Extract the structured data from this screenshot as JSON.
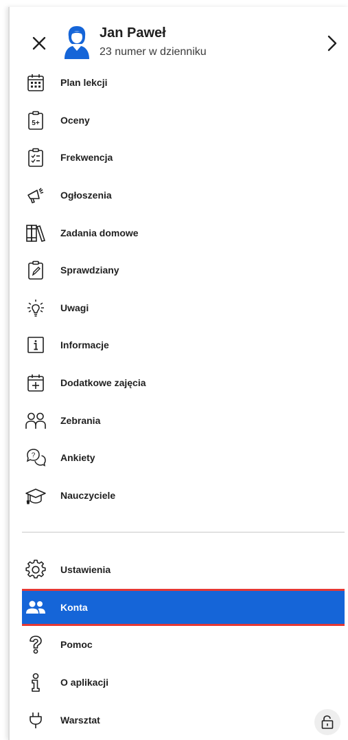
{
  "header": {
    "user_name": "Jan Paweł",
    "user_subtitle": "23 numer w dzienniku",
    "avatar_color": "#1565d8"
  },
  "menu": {
    "items": [
      {
        "label": "Plan lekcji",
        "icon": "calendar-grid-icon"
      },
      {
        "label": "Oceny",
        "icon": "grade-clipboard-icon"
      },
      {
        "label": "Frekwencja",
        "icon": "checklist-clipboard-icon"
      },
      {
        "label": "Ogłoszenia",
        "icon": "megaphone-icon"
      },
      {
        "label": "Zadania domowe",
        "icon": "books-icon"
      },
      {
        "label": "Sprawdziany",
        "icon": "clipboard-pencil-icon"
      },
      {
        "label": "Uwagi",
        "icon": "lightbulb-icon"
      },
      {
        "label": "Informacje",
        "icon": "info-box-icon"
      },
      {
        "label": "Dodatkowe zajęcia",
        "icon": "calendar-plus-icon"
      },
      {
        "label": "Zebrania",
        "icon": "people-outline-icon"
      },
      {
        "label": "Ankiety",
        "icon": "question-chat-icon"
      },
      {
        "label": "Nauczyciele",
        "icon": "graduation-cap-icon"
      }
    ],
    "secondary": [
      {
        "label": "Ustawienia",
        "icon": "gear-icon"
      },
      {
        "label": "Konta",
        "icon": "accounts-icon",
        "active": true
      },
      {
        "label": "Pomoc",
        "icon": "question-mark-icon"
      },
      {
        "label": "O aplikacji",
        "icon": "info-person-icon"
      },
      {
        "label": "Warsztat",
        "icon": "plug-icon"
      }
    ]
  },
  "colors": {
    "accent": "#1565d8",
    "active_border": "#e53935",
    "divider": "#c9c9c9"
  }
}
